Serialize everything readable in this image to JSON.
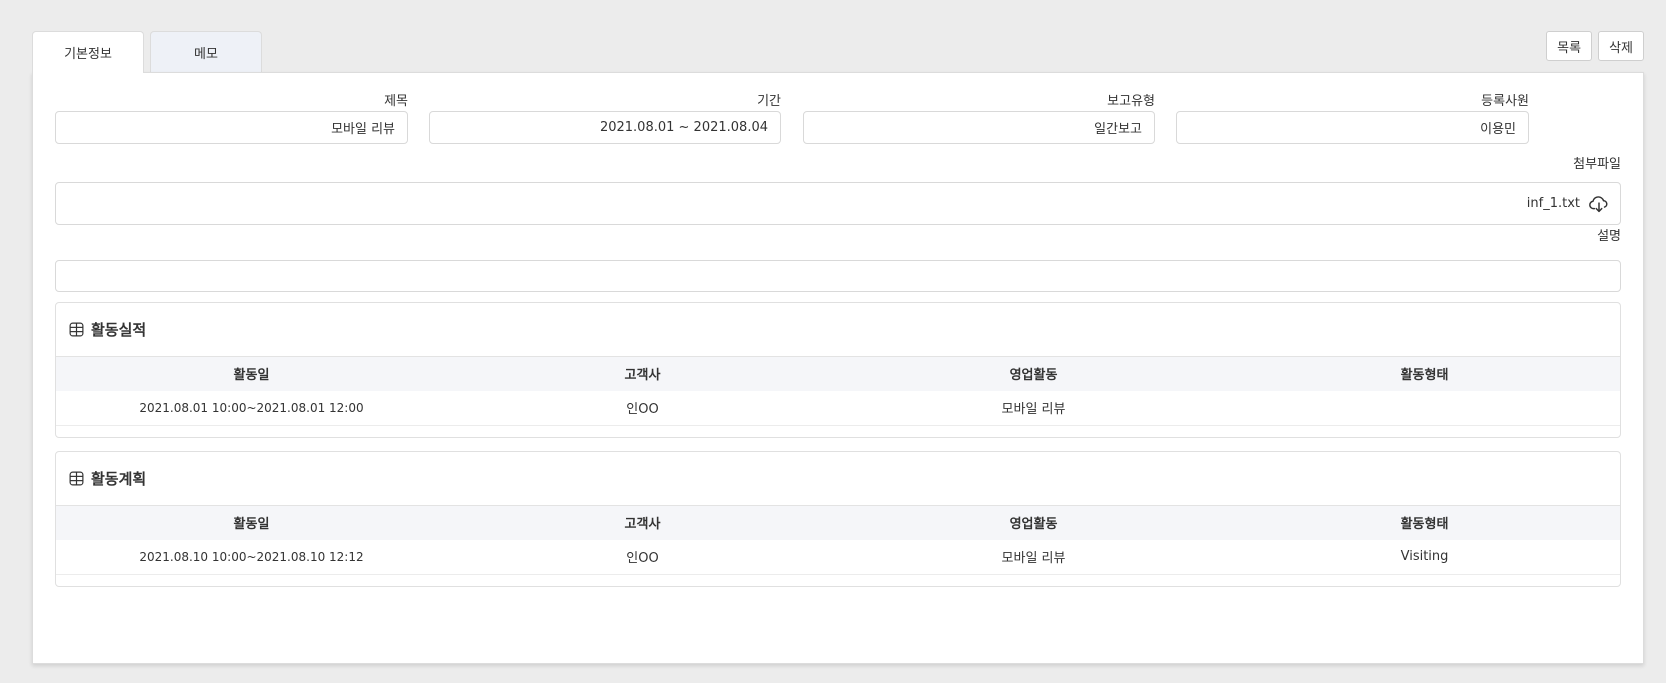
{
  "tabs": [
    {
      "label": "기본정보",
      "active": true
    },
    {
      "label": "메모",
      "active": false
    }
  ],
  "actions": {
    "list_label": "목록",
    "delete_label": "삭제"
  },
  "form": {
    "title": {
      "label": "제목",
      "value": "모바일 리뷰"
    },
    "period": {
      "label": "기간",
      "value": "2021.08.01 ~ 2021.08.04"
    },
    "report_type": {
      "label": "보고유형",
      "value": "일간보고"
    },
    "registrant": {
      "label": "등록사원",
      "value": "이용민"
    },
    "attachment": {
      "label": "첨부파일",
      "file_name": "inf_1.txt",
      "icon": "cloud-download-icon"
    },
    "description": {
      "label": "설명",
      "value": ""
    }
  },
  "activity_results": {
    "title": "활동실적",
    "icon": "database-icon",
    "columns": [
      "활동일",
      "고객사",
      "영업활동",
      "활동형태"
    ],
    "rows": [
      [
        "2021.08.01 10:00~2021.08.01 12:00",
        "인OO",
        "모바일 리뷰",
        ""
      ]
    ]
  },
  "activity_plans": {
    "title": "활동계획",
    "icon": "database-icon",
    "columns": [
      "활동일",
      "고객사",
      "영업활동",
      "활동형태"
    ],
    "rows": [
      [
        "2021.08.10 10:00~2021.08.10 12:12",
        "인OO",
        "모바일 리뷰",
        "Visiting"
      ]
    ]
  }
}
